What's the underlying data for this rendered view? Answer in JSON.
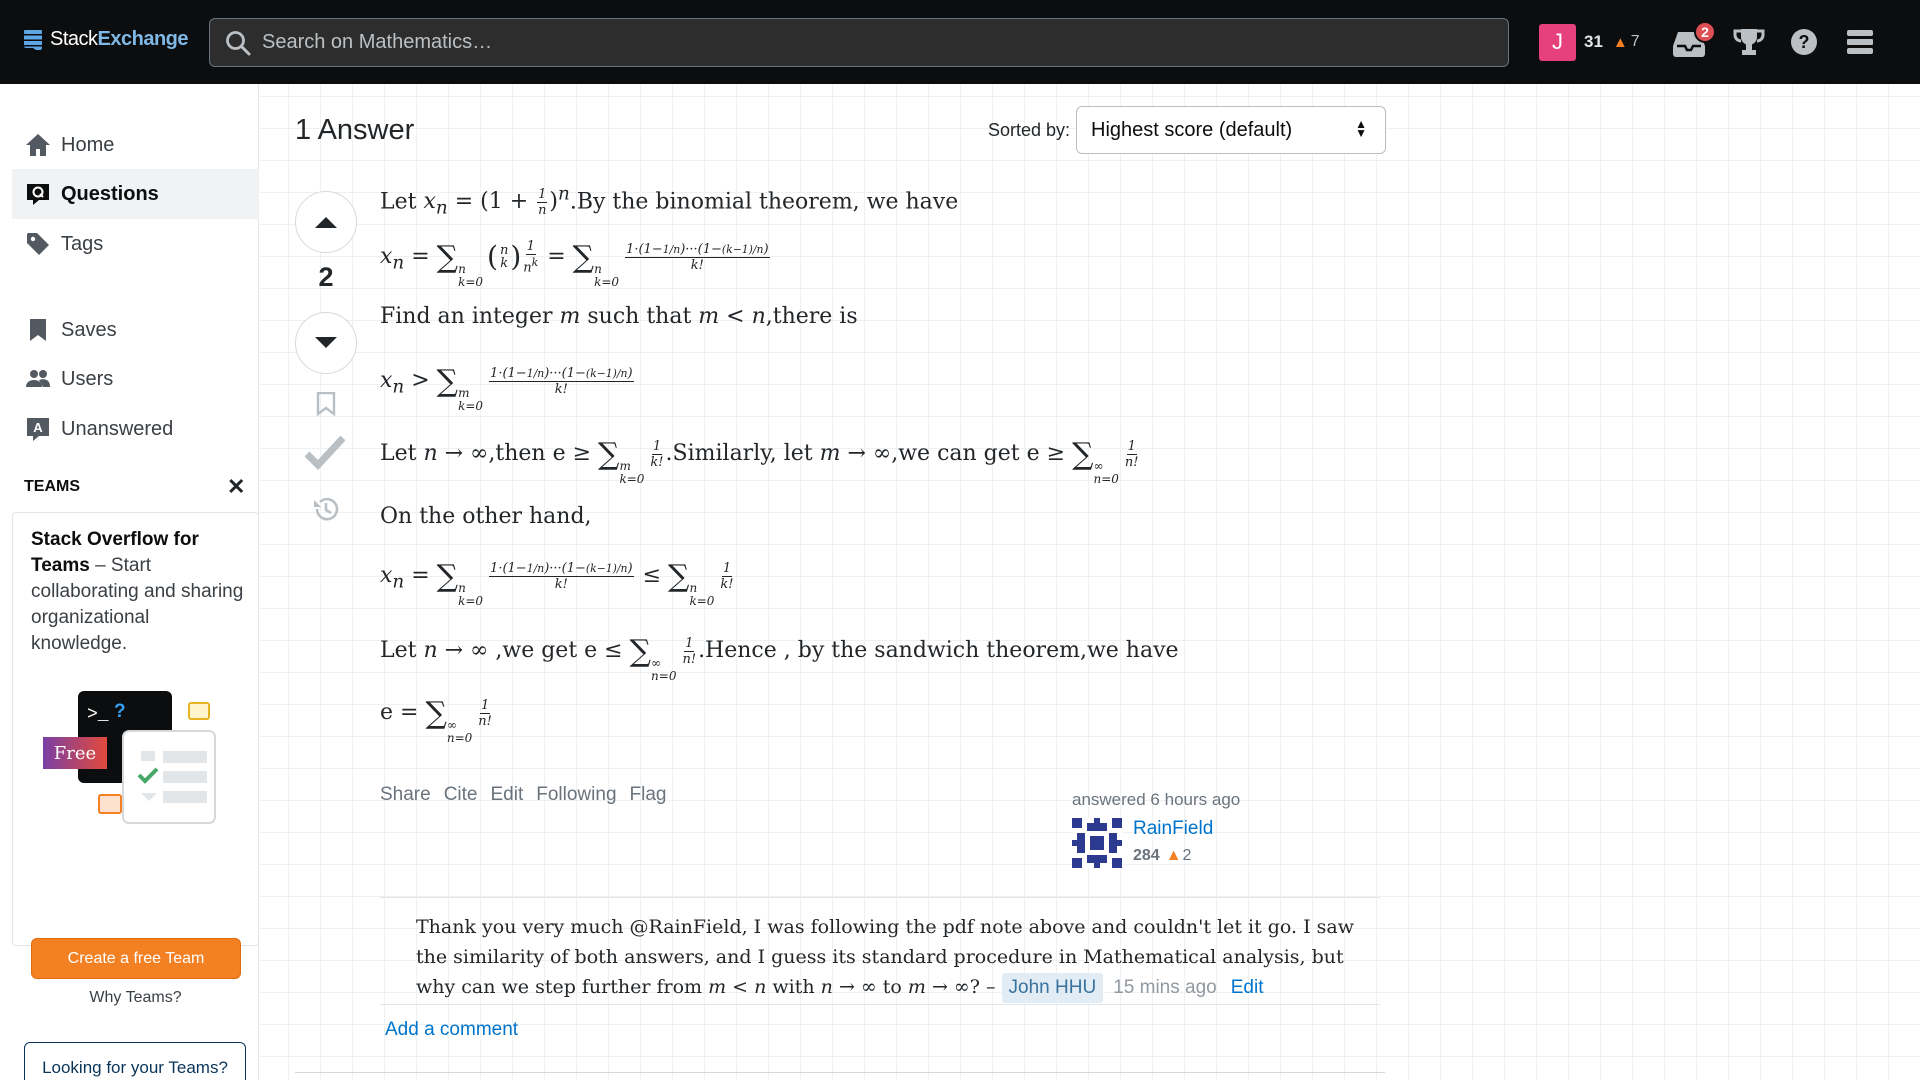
{
  "header": {
    "logo_stack": "Stack",
    "logo_exchange": "Exchange",
    "search_placeholder": "Search on Mathematics…",
    "avatar_letter": "J",
    "reputation": "31",
    "bronze_count": "7",
    "inbox_count": "2"
  },
  "sidebar": {
    "items": [
      {
        "label": "Home",
        "icon": "home-icon"
      },
      {
        "label": "Questions",
        "icon": "questions-icon"
      },
      {
        "label": "Tags",
        "icon": "tag-icon"
      },
      {
        "label": "Saves",
        "icon": "bookmark-icon"
      },
      {
        "label": "Users",
        "icon": "users-icon"
      },
      {
        "label": "Unanswered",
        "icon": "unanswered-icon"
      }
    ],
    "teams_heading": "TEAMS",
    "teams_title": "Stack Overflow for Teams",
    "teams_desc": " – Start collaborating and sharing organizational knowledge.",
    "free_label": "Free",
    "create_button": "Create a free Team",
    "why_teams": "Why Teams?",
    "looking_button": "Looking for your Teams?"
  },
  "answers": {
    "heading": "1 Answer",
    "sorted_label": "Sorted by:",
    "sort_value": "Highest score (default)"
  },
  "post": {
    "score": "2",
    "text": {
      "l1_a": "Let ",
      "l1_b": ".By the binomial theorem, we have",
      "l3_a": "Find an integer ",
      "l3_b": " such that ",
      "l3_c": ",there is",
      "l5_a": "Let ",
      "l5_b": ",then e ",
      "l5_c": ".Similarly, let ",
      "l5_d": ",we can get e ",
      "l6": "On the other hand,",
      "l8_a": "Let ",
      "l8_b": " ,we get e ",
      "l8_c": ".Hence , by the sandwich theorem,we have",
      "l9_a": "e "
    },
    "menu": [
      "Share",
      "Cite",
      "Edit",
      "Following",
      "Flag"
    ],
    "answered": "answered 6 hours ago",
    "user_name": "RainField",
    "user_rep": "284",
    "user_bronze": "2"
  },
  "comment": {
    "text_a": "Thank you very much @RainField, I was following the pdf note above and couldn't let it go. I saw the similarity of both answers, and I guess its standard procedure in Mathematical analysis, but why can we step further from ",
    "text_b": " with ",
    "text_c": " to ",
    "text_d": "? – ",
    "user": "John HHU",
    "time": "15 mins ago",
    "edit": "Edit",
    "add_comment": "Add a comment"
  }
}
